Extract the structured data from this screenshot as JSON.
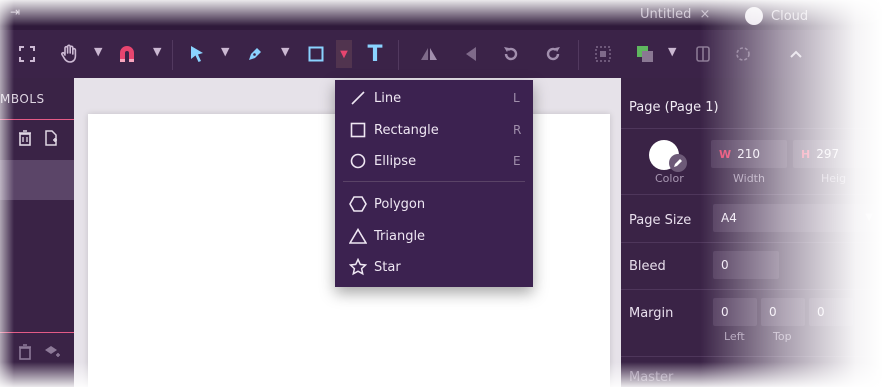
{
  "topbar": {
    "doc_tab": "Untitled",
    "close_glyph": "×",
    "cloud_label": "Cloud",
    "corner_glyph": "⇥"
  },
  "left_panel": {
    "header": "MBOLS"
  },
  "menu": {
    "items": [
      {
        "label": "Line",
        "shortcut": "L",
        "icon": "line-icon"
      },
      {
        "label": "Rectangle",
        "shortcut": "R",
        "icon": "rectangle-icon"
      },
      {
        "label": "Ellipse",
        "shortcut": "E",
        "icon": "ellipse-icon"
      },
      {
        "label": "Polygon",
        "shortcut": "",
        "icon": "polygon-icon"
      },
      {
        "label": "Triangle",
        "shortcut": "",
        "icon": "triangle-icon"
      },
      {
        "label": "Star",
        "shortcut": "",
        "icon": "star-icon"
      }
    ]
  },
  "right_panel": {
    "title": "Page (Page 1)",
    "color_label": "Color",
    "width_prefix": "W",
    "width_value": "210",
    "width_label": "Width",
    "height_prefix": "H",
    "height_value": "297",
    "height_label": "Heig",
    "page_size_label": "Page Size",
    "page_size_value": "A4",
    "bleed_label": "Bleed",
    "bleed_value": "0",
    "margin_label": "Margin",
    "margin_left_value": "0",
    "margin_top_value": "0",
    "margin_right_value": "0",
    "margin_left_label": "Left",
    "margin_top_label": "Top",
    "master_label": "Master"
  },
  "colors": {
    "accent": "#e8456f",
    "toolbar_bg": "#3b2348",
    "panel_bg": "#3a2346",
    "menu_bg": "#3c2250",
    "canvas_bg": "#e6e2e9"
  }
}
